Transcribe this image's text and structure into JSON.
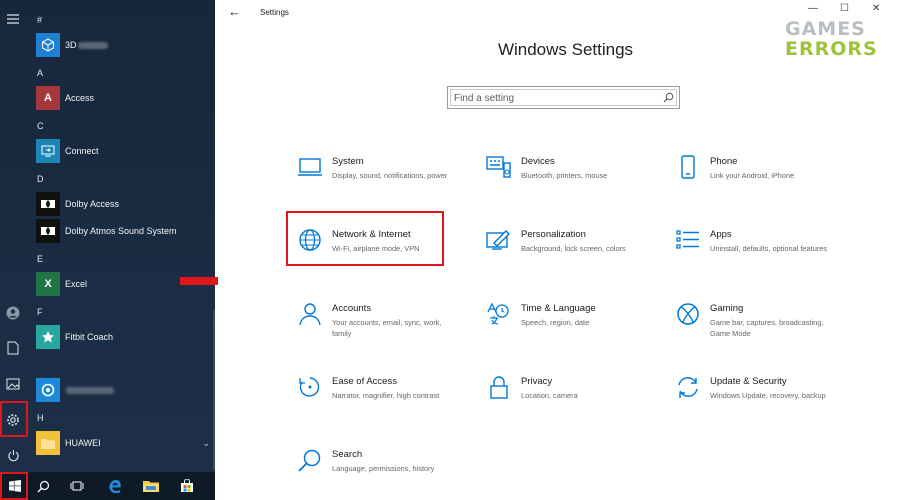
{
  "start_menu": {
    "letters": [
      "#",
      "A",
      "C",
      "D",
      "E",
      "F",
      "H"
    ],
    "apps": [
      {
        "label": "3D",
        "icon": "cube-icon",
        "color": "#1f7fd1"
      },
      {
        "label": "Access",
        "icon": "access-icon",
        "color": "#a4373a"
      },
      {
        "label": "Connect",
        "icon": "connect-icon",
        "color": "#1a86b8"
      },
      {
        "label": "Dolby Access",
        "icon": "dolby-icon",
        "color": "#111111"
      },
      {
        "label": "Dolby Atmos Sound System",
        "icon": "dolby-icon",
        "color": "#111111"
      },
      {
        "label": "Excel",
        "icon": "excel-icon",
        "color": "#217346"
      },
      {
        "label": "Fitbit Coach",
        "icon": "fitbit-icon",
        "color": "#2aa6a0"
      },
      {
        "label": "",
        "icon": "app-icon",
        "color": "#1d88d6"
      },
      {
        "label": "HUAWEI",
        "icon": "folder-icon",
        "color": "#f3c13a"
      }
    ],
    "rail": [
      "hamburger-menu-icon",
      "user-icon",
      "document-icon",
      "pictures-icon",
      "settings-gear-icon",
      "power-icon"
    ]
  },
  "taskbar": [
    "windows-start-icon",
    "search-icon",
    "task-view-icon",
    "edge-icon",
    "file-explorer-icon",
    "store-icon"
  ],
  "window": {
    "title": "Settings",
    "back": "←",
    "minimize": "—",
    "maximize": "☐",
    "close": "✕"
  },
  "heading": "Windows Settings",
  "search": {
    "placeholder": "Find a setting"
  },
  "categories": [
    {
      "title": "System",
      "desc": "Display, sound, notifications, power"
    },
    {
      "title": "Devices",
      "desc": "Bluetooth, printers, mouse"
    },
    {
      "title": "Phone",
      "desc": "Link your Android, iPhone"
    },
    {
      "title": "Network & Internet",
      "desc": "Wi-Fi, airplane mode, VPN"
    },
    {
      "title": "Personalization",
      "desc": "Background, lock screen, colors"
    },
    {
      "title": "Apps",
      "desc": "Uninstall, defaults, optional features"
    },
    {
      "title": "Accounts",
      "desc": "Your accounts, email, sync, work, family"
    },
    {
      "title": "Time & Language",
      "desc": "Speech, region, date"
    },
    {
      "title": "Gaming",
      "desc": "Game bar, captures, broadcasting, Game Mode"
    },
    {
      "title": "Ease of Access",
      "desc": "Narrator, magnifier, high contrast"
    },
    {
      "title": "Privacy",
      "desc": "Location, camera"
    },
    {
      "title": "Update & Security",
      "desc": "Windows Update, recovery, backup"
    },
    {
      "title": "Search",
      "desc": "Language, permissions, history"
    }
  ],
  "logo": {
    "line1": "GAMES",
    "line2": "ERRORS"
  },
  "colors": {
    "accent": "#0078d7",
    "highlight": "#e0161c",
    "start_bg": "#1b2d44"
  }
}
